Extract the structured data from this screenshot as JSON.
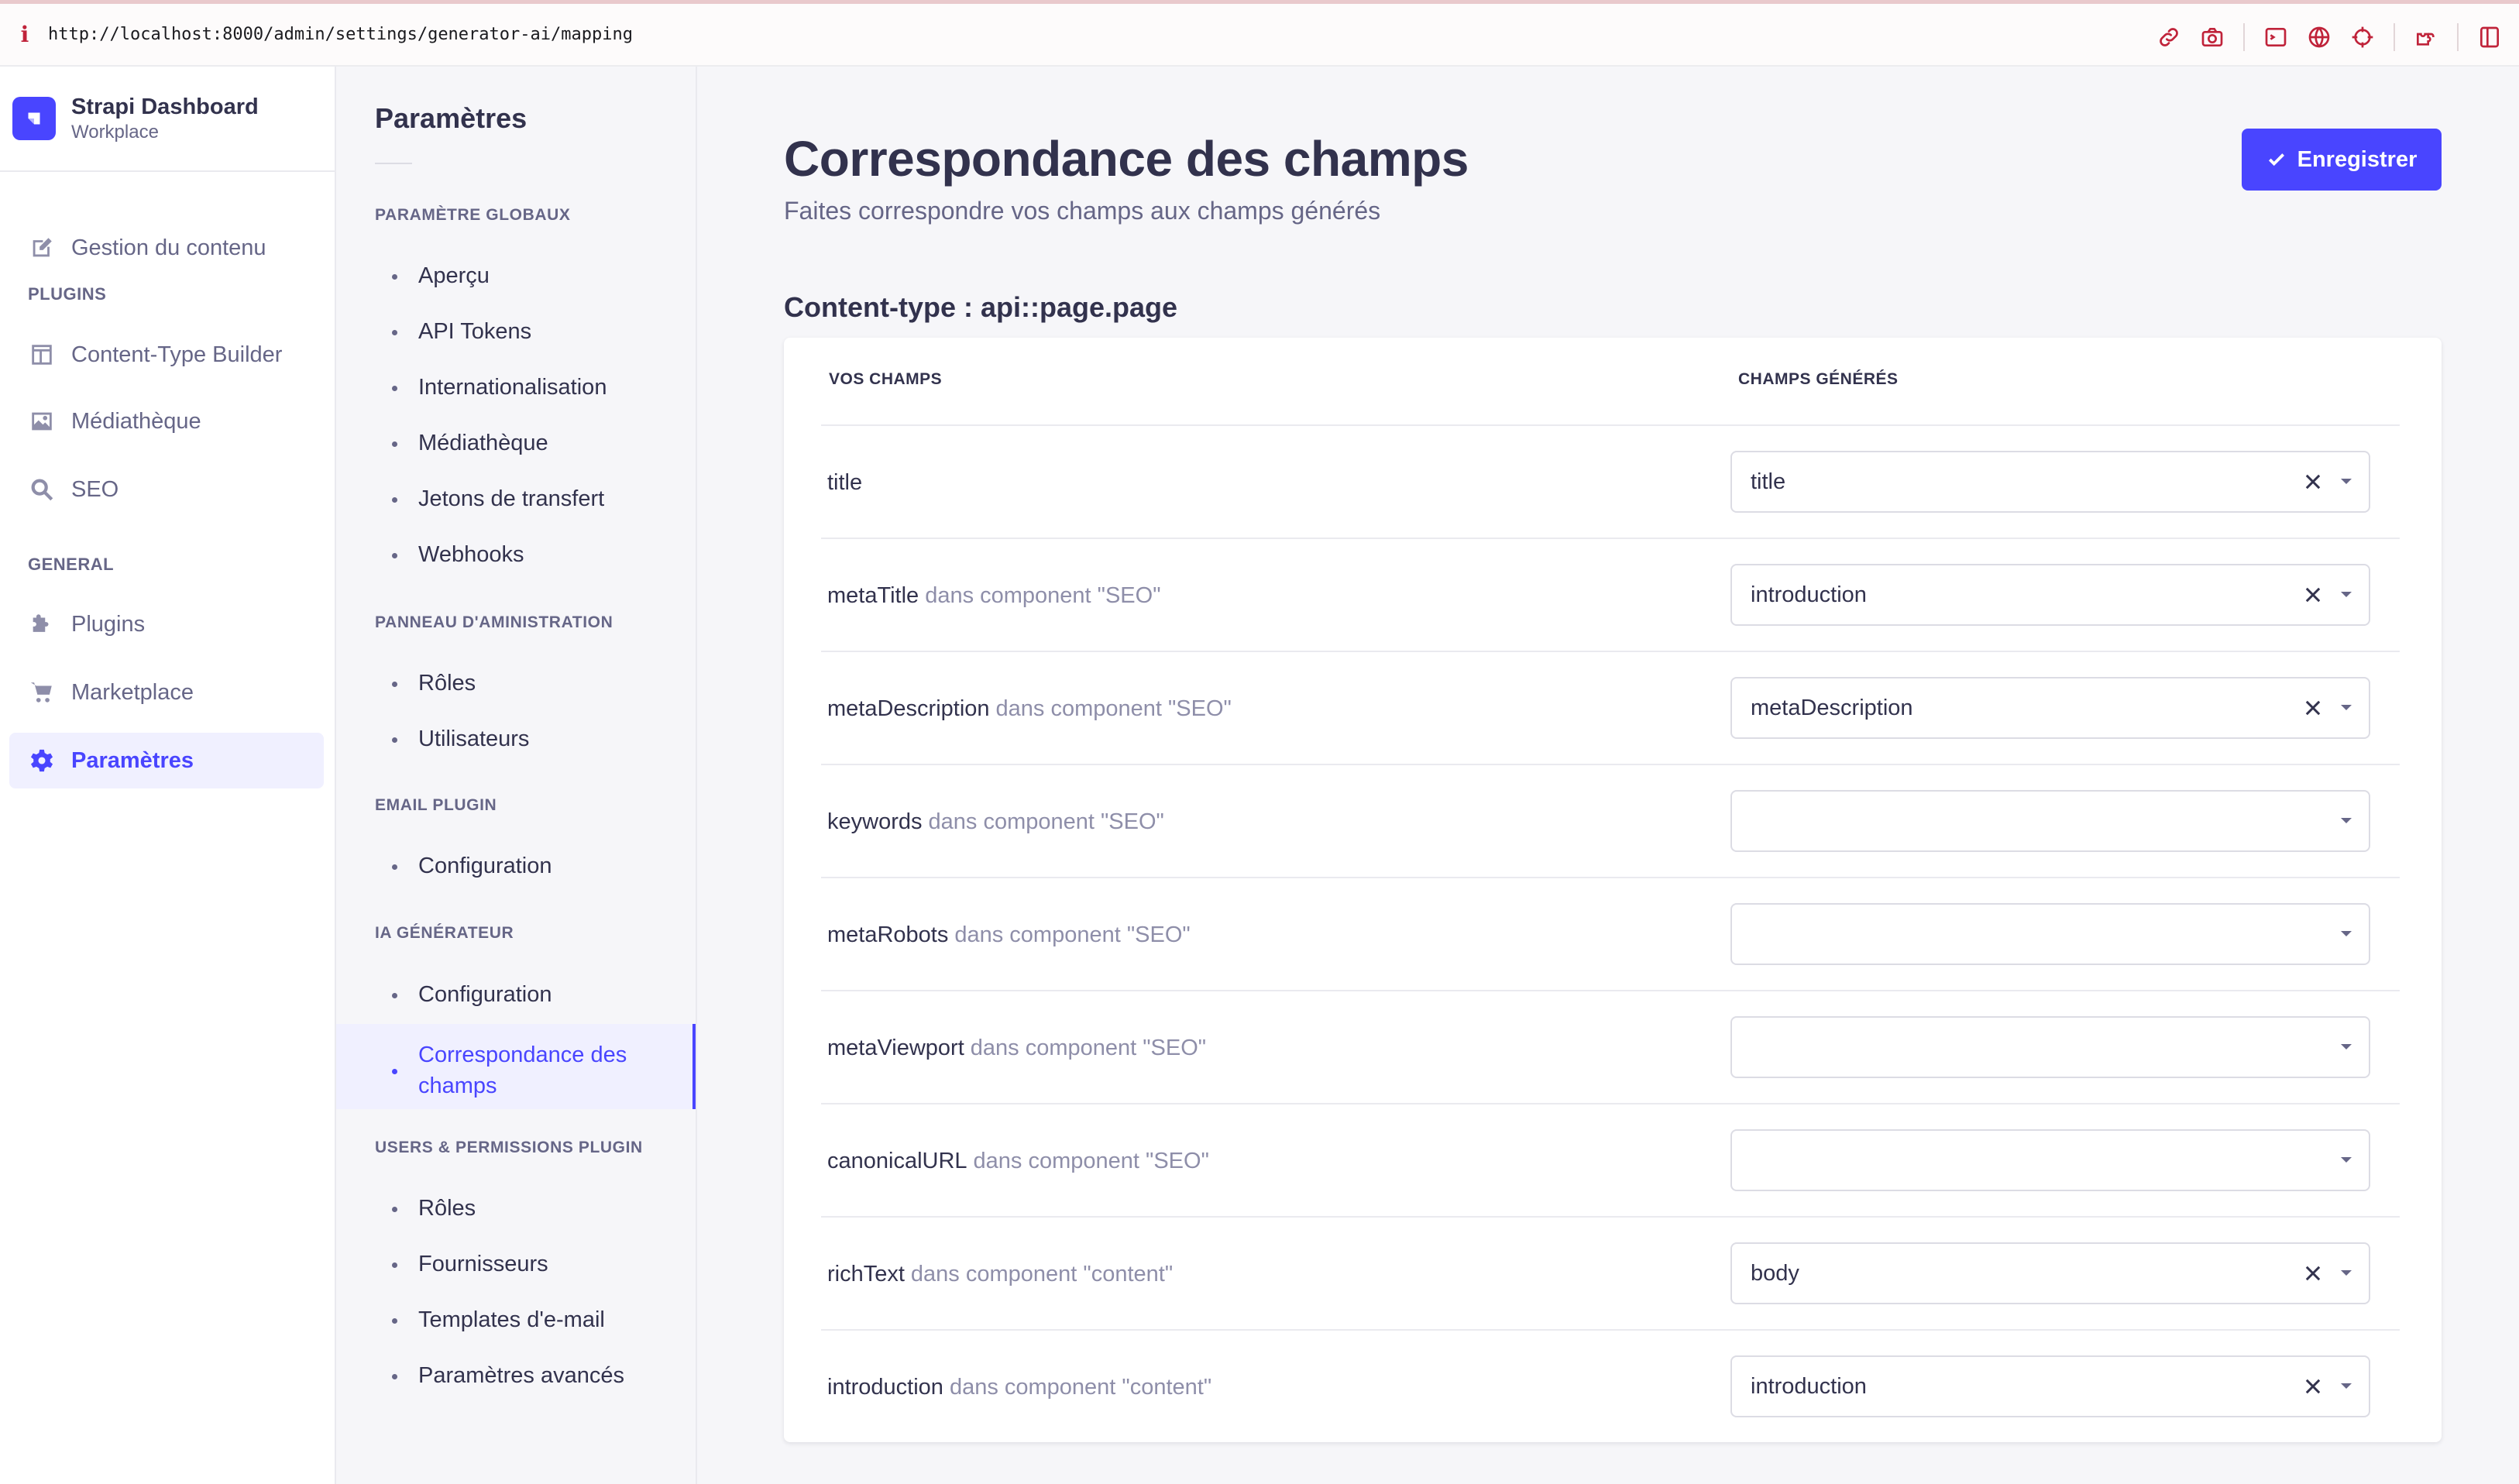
{
  "browser": {
    "info_glyph": "i",
    "url": "http://localhost:8000/admin/settings/generator-ai/mapping",
    "tools": [
      "link-icon",
      "camera-icon",
      "terminal-icon",
      "globe-icon",
      "crosshair-icon",
      "extension-icon",
      "sidebar-icon"
    ]
  },
  "brand": {
    "title": "Strapi Dashboard",
    "subtitle": "Workplace"
  },
  "nav": {
    "content_manager": "Gestion du contenu",
    "plugins_section": "PLUGINS",
    "content_type_builder": "Content-Type Builder",
    "media_library": "Médiathèque",
    "seo": "SEO",
    "general_section": "GENERAL",
    "plugins": "Plugins",
    "marketplace": "Marketplace",
    "settings": "Paramètres"
  },
  "subnav": {
    "title": "Paramètres",
    "global_section": "PARAMÈTRE GLOBAUX",
    "global_items": [
      "Aperçu",
      "API Tokens",
      "Internationalisation",
      "Médiathèque",
      "Jetons de transfert",
      "Webhooks"
    ],
    "admin_section": "PANNEAU D'AMINISTRATION",
    "admin_items": [
      "Rôles",
      "Utilisateurs"
    ],
    "email_section": "EMAIL PLUGIN",
    "email_items": [
      "Configuration"
    ],
    "ai_section": "IA GÉNÉRATEUR",
    "ai_items": [
      "Configuration",
      "Correspondance des champs"
    ],
    "users_section": "USERS & PERMISSIONS PLUGIN",
    "users_items": [
      "Rôles",
      "Fournisseurs",
      "Templates d'e-mail",
      "Paramètres avancés"
    ]
  },
  "main": {
    "title": "Correspondance des champs",
    "subtitle": "Faites correspondre vos champs aux champs générés",
    "save_label": "Enregistrer",
    "content_type_heading": "Content-type : api::page.page",
    "col_your_fields": "VOS CHAMPS",
    "col_generated_fields": "CHAMPS GÉNÉRÉS",
    "rows": [
      {
        "field": "title",
        "component": "",
        "value": "title",
        "clearable": true
      },
      {
        "field": "metaTitle",
        "component": "dans component \"SEO\"",
        "value": "introduction",
        "clearable": true
      },
      {
        "field": "metaDescription",
        "component": "dans component \"SEO\"",
        "value": "metaDescription",
        "clearable": true
      },
      {
        "field": "keywords",
        "component": "dans component \"SEO\"",
        "value": "",
        "clearable": false
      },
      {
        "field": "metaRobots",
        "component": "dans component \"SEO\"",
        "value": "",
        "clearable": false
      },
      {
        "field": "metaViewport",
        "component": "dans component \"SEO\"",
        "value": "",
        "clearable": false
      },
      {
        "field": "canonicalURL",
        "component": "dans component \"SEO\"",
        "value": "",
        "clearable": false
      },
      {
        "field": "richText",
        "component": "dans component \"content\"",
        "value": "body",
        "clearable": true
      },
      {
        "field": "introduction",
        "component": "dans component \"content\"",
        "value": "introduction",
        "clearable": true
      }
    ]
  },
  "colors": {
    "primary": "#4945ff",
    "primary_light": "#f0f0ff",
    "browser_accent": "#c0233a"
  }
}
